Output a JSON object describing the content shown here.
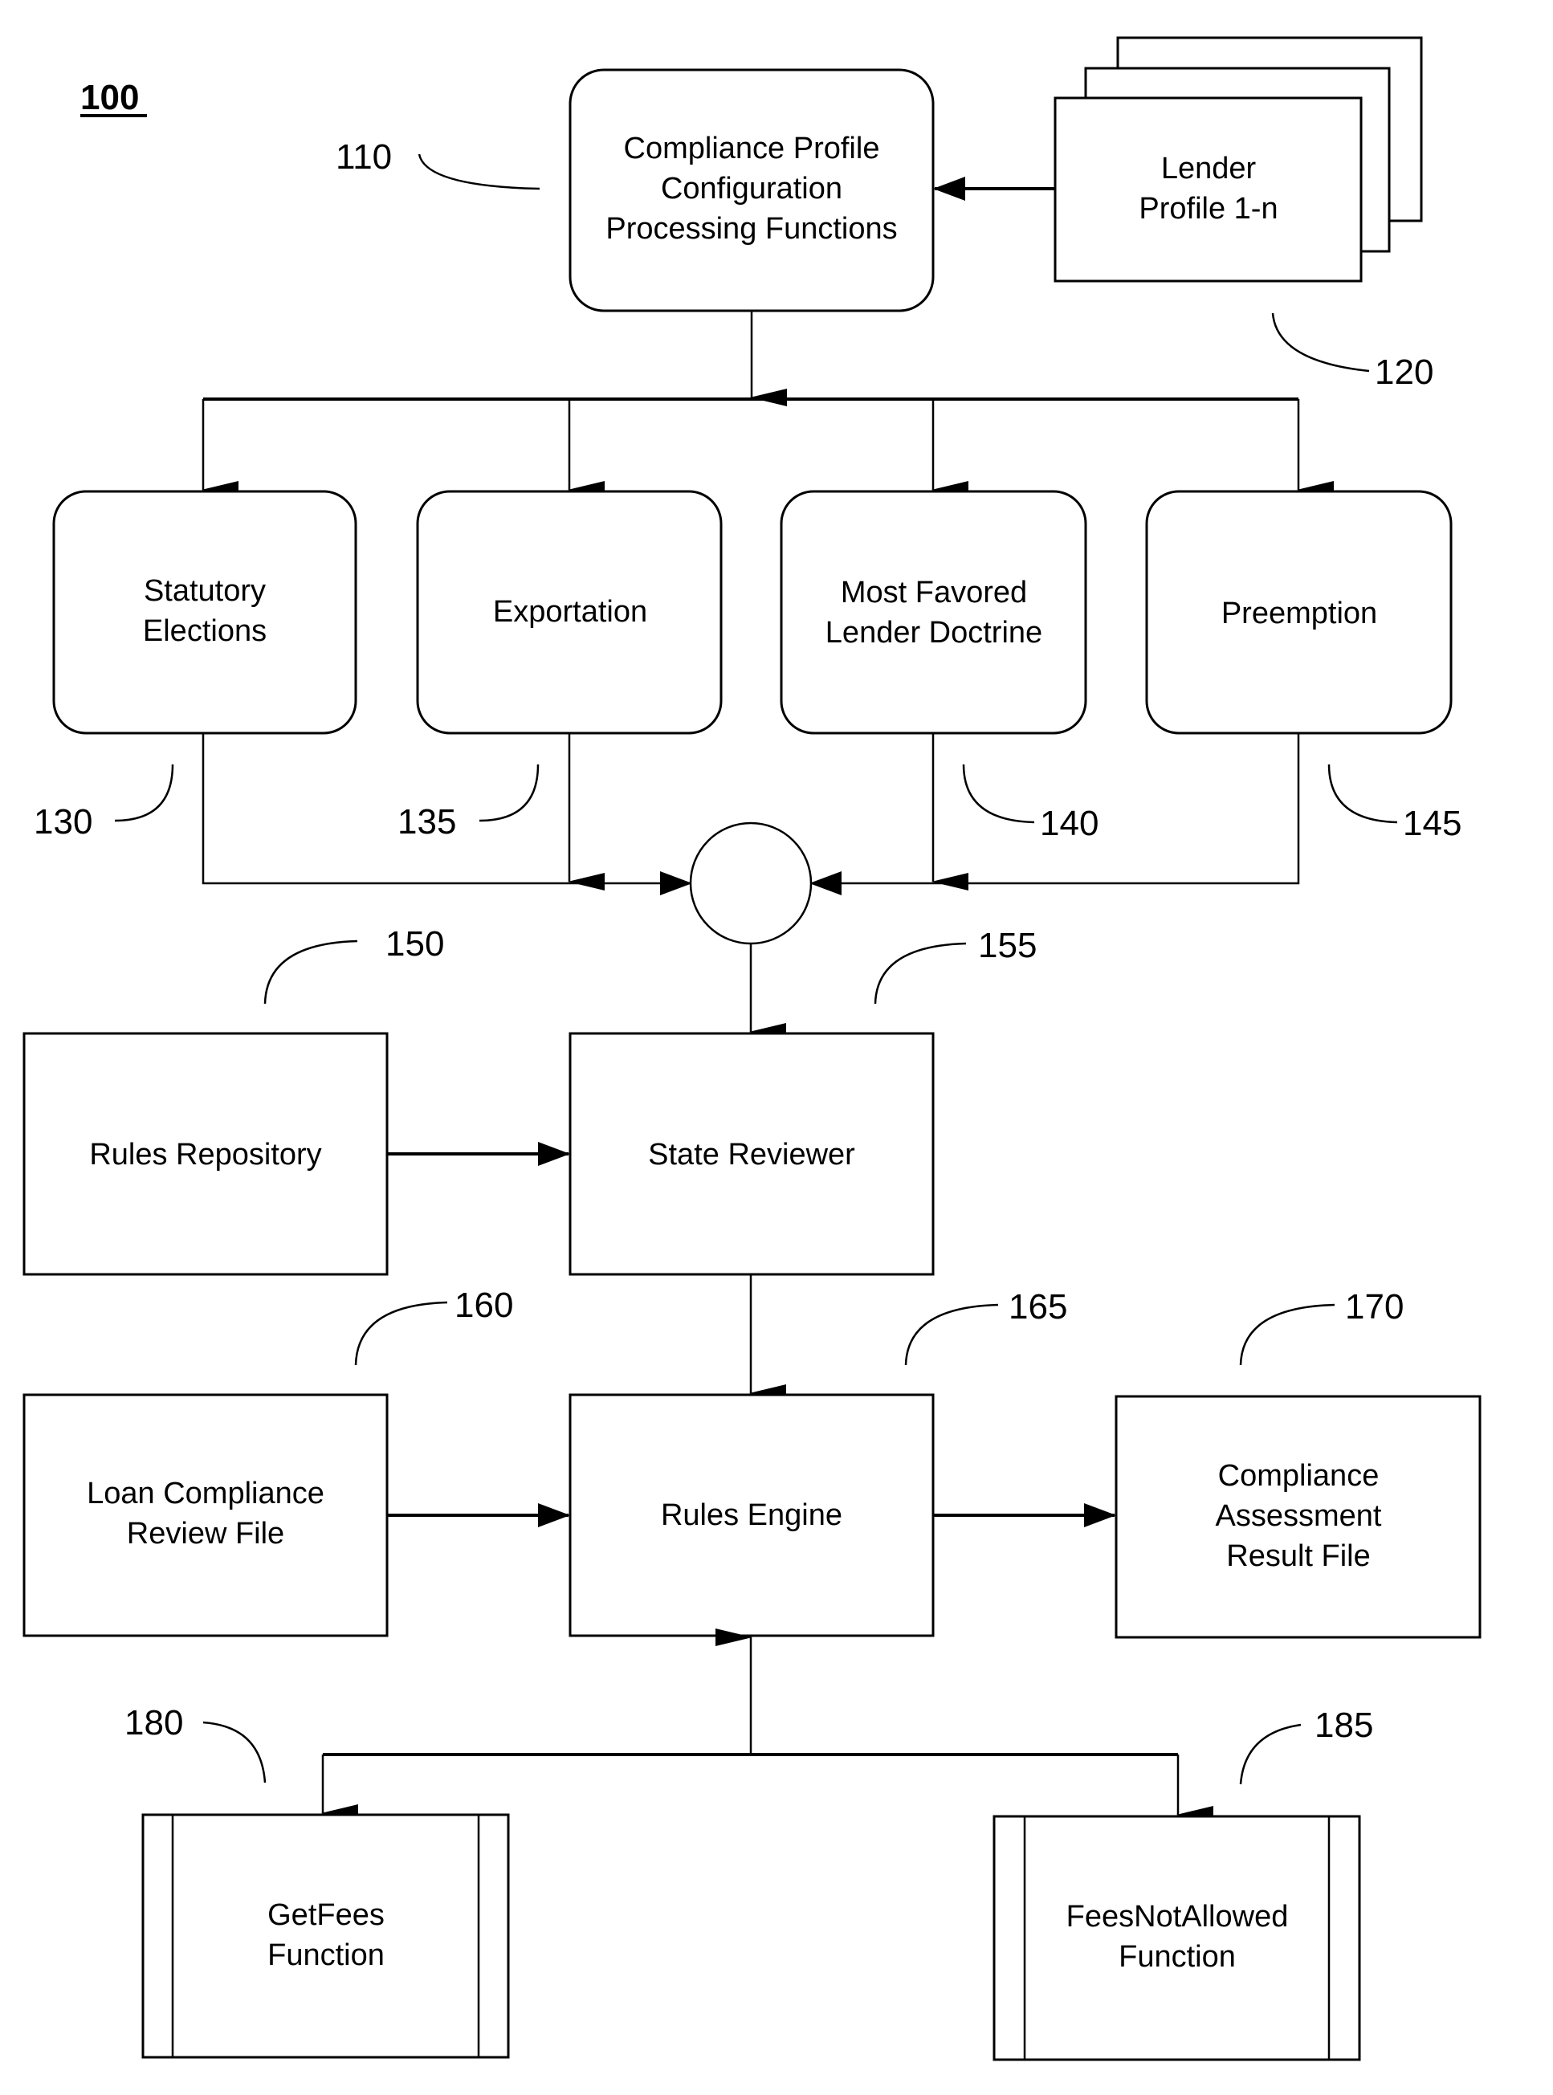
{
  "figure": {
    "label": "100"
  },
  "nodes": {
    "compliance_profile": {
      "ref": "110",
      "lines": [
        "Compliance Profile",
        "Configuration",
        "Processing Functions"
      ]
    },
    "lender_profile": {
      "ref": "120",
      "lines": [
        "Lender",
        "Profile 1-n"
      ]
    },
    "statutory_elections": {
      "ref": "130",
      "lines": [
        "Statutory",
        "Elections"
      ]
    },
    "exportation": {
      "ref": "135",
      "lines": [
        "Exportation"
      ]
    },
    "most_favored": {
      "ref": "140",
      "lines": [
        "Most Favored",
        "Lender Doctrine"
      ]
    },
    "preemption": {
      "ref": "145",
      "lines": [
        "Preemption"
      ]
    },
    "rules_repository": {
      "ref": "150",
      "lines": [
        "Rules Repository"
      ]
    },
    "state_reviewer": {
      "ref": "155",
      "lines": [
        "State Reviewer"
      ]
    },
    "loan_compliance": {
      "ref": "160",
      "lines": [
        "Loan Compliance",
        "Review File"
      ]
    },
    "rules_engine": {
      "ref": "165",
      "lines": [
        "Rules Engine"
      ]
    },
    "compliance_assessment": {
      "ref": "170",
      "lines": [
        "Compliance",
        "Assessment",
        "Result File"
      ]
    },
    "get_fees": {
      "ref": "180",
      "lines": [
        "GetFees",
        "Function"
      ]
    },
    "fees_not_allowed": {
      "ref": "185",
      "lines": [
        "FeesNotAllowed",
        "Function"
      ]
    }
  },
  "edges": [
    {
      "from": "lender_profile",
      "to": "compliance_profile"
    },
    {
      "from": "compliance_profile",
      "to": "statutory_elections"
    },
    {
      "from": "compliance_profile",
      "to": "exportation"
    },
    {
      "from": "compliance_profile",
      "to": "most_favored"
    },
    {
      "from": "compliance_profile",
      "to": "preemption"
    },
    {
      "from": "statutory_elections",
      "to": "junction"
    },
    {
      "from": "exportation",
      "to": "junction"
    },
    {
      "from": "most_favored",
      "to": "junction"
    },
    {
      "from": "preemption",
      "to": "junction"
    },
    {
      "from": "junction",
      "to": "state_reviewer"
    },
    {
      "from": "rules_repository",
      "to": "state_reviewer"
    },
    {
      "from": "state_reviewer",
      "to": "rules_engine"
    },
    {
      "from": "loan_compliance",
      "to": "rules_engine"
    },
    {
      "from": "rules_engine",
      "to": "compliance_assessment"
    },
    {
      "from": "rules_engine",
      "to": "get_fees",
      "bidirectional": true
    },
    {
      "from": "rules_engine",
      "to": "fees_not_allowed",
      "bidirectional": true
    }
  ]
}
